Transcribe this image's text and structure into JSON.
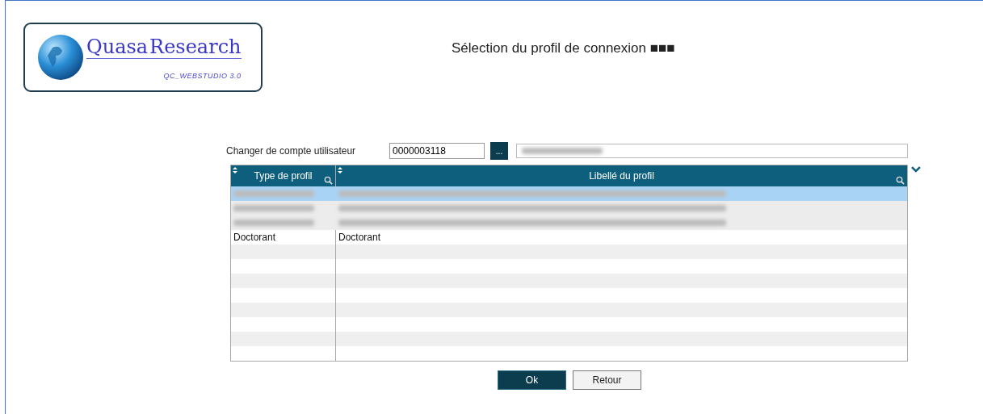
{
  "logo": {
    "name_part1": "Quasa",
    "name_part2": "Research",
    "subtitle": "QC_WEBSTUDIO 3.0"
  },
  "title": "Sélection du profil de connexion ■■■",
  "account": {
    "label": "Changer de compte utilisateur",
    "value": "0000003118",
    "browse_button": "..."
  },
  "table": {
    "columns": [
      "Type de profil",
      "Libellé du profil"
    ],
    "rows": [
      {
        "kind": "redacted",
        "selected": true
      },
      {
        "kind": "redacted",
        "selected": false
      },
      {
        "kind": "redacted",
        "selected": false
      },
      {
        "kind": "text",
        "selected": false,
        "cells": [
          "Doctorant",
          "Doctorant"
        ]
      }
    ]
  },
  "buttons": [
    {
      "label": "Ok",
      "primary": true
    },
    {
      "label": "Retour",
      "primary": false
    }
  ]
}
